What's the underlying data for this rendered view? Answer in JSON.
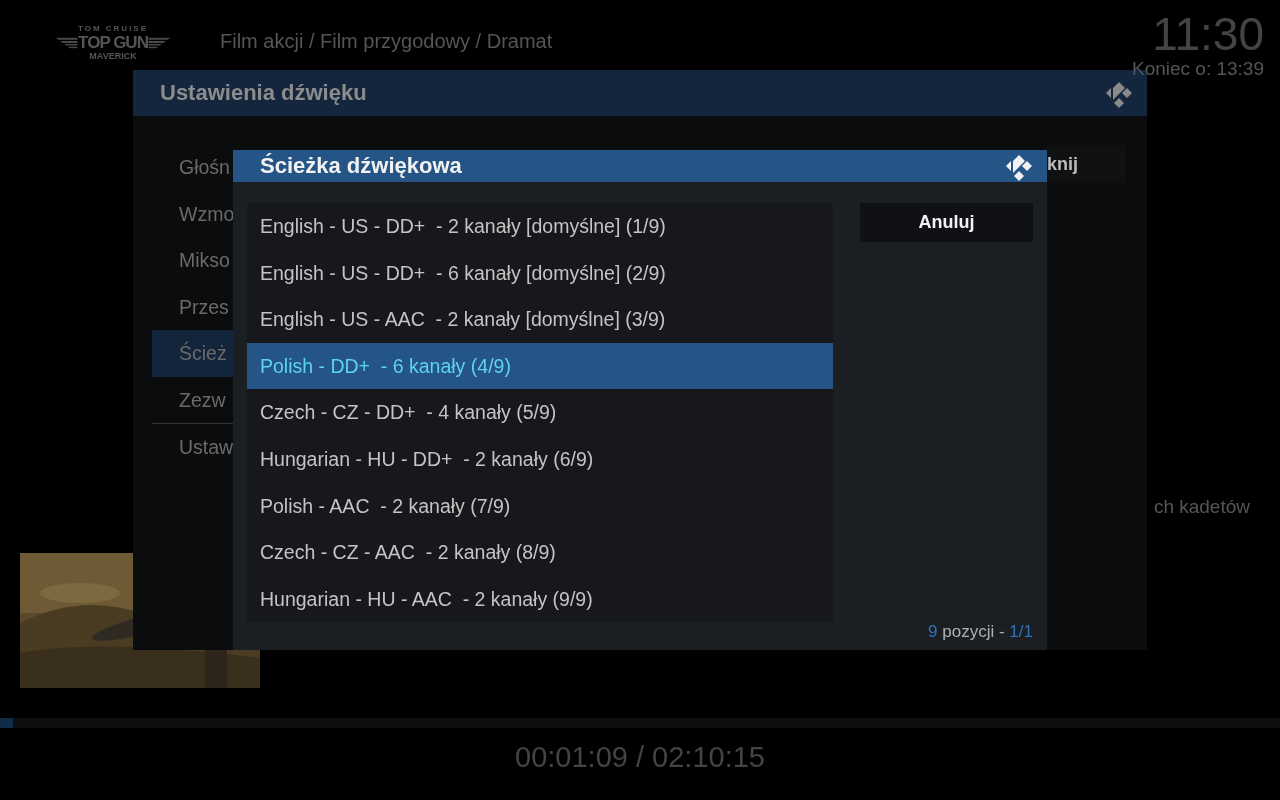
{
  "logo": {
    "top": "TOM CRUISE",
    "title": "TOP GUN",
    "subtitle": "MAVERICK"
  },
  "genres": "Film akcji / Film przygodowy / Dramat",
  "clock": "11:30",
  "end_time": "Koniec o: 13:39",
  "plot_fragment": "ch kadetów",
  "progress": {
    "level": 0.01
  },
  "time": "00:01:09 / 02:10:15",
  "settings_dialog": {
    "title": "Ustawienia dźwięku",
    "items": [
      {
        "label": "Głośn",
        "selected": false
      },
      {
        "label": "Wzmo",
        "selected": false
      },
      {
        "label": "Mikso",
        "selected": false
      },
      {
        "label": "Przes",
        "selected": false
      },
      {
        "label": "Ścież",
        "selected": true
      },
      {
        "label": "Zezw",
        "selected": false
      },
      {
        "label": "Ustaw",
        "selected": false
      }
    ],
    "button": "knij"
  },
  "track_dialog": {
    "title": "Ścieżka dźwiękowa",
    "tracks": [
      {
        "label": "English - US - DD+  - 2 kanały [domyślne] (1/9)",
        "selected": false
      },
      {
        "label": "English - US - DD+  - 6 kanały [domyślne] (2/9)",
        "selected": false
      },
      {
        "label": "English - US - AAC  - 2 kanały [domyślne] (3/9)",
        "selected": false
      },
      {
        "label": "Polish - DD+  - 6 kanały (4/9)",
        "selected": true
      },
      {
        "label": "Czech - CZ - DD+  - 4 kanały (5/9)",
        "selected": false
      },
      {
        "label": "Hungarian - HU - DD+  - 2 kanały (6/9)",
        "selected": false
      },
      {
        "label": "Polish - AAC  - 2 kanały (7/9)",
        "selected": false
      },
      {
        "label": "Czech - CZ - AAC  - 2 kanały (8/9)",
        "selected": false
      },
      {
        "label": "Hungarian - HU - AAC  - 2 kanały (9/9)",
        "selected": false
      }
    ],
    "cancel": "Anuluj",
    "footer": {
      "count": "9",
      "label": "pozycji -",
      "page": "1/1"
    }
  }
}
